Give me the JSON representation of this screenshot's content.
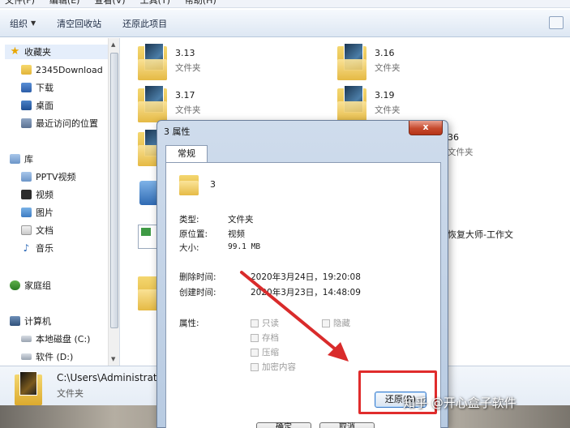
{
  "menubar": {
    "items": [
      "文件(F)",
      "编辑(E)",
      "查看(V)",
      "工具(T)",
      "帮助(H)"
    ]
  },
  "toolbar": {
    "organize_label": "组织",
    "empty_recycle_label": "清空回收站",
    "restore_item_label": "还原此项目"
  },
  "nav": {
    "favorites": "收藏夹",
    "fav_items": [
      "2345Download",
      "下载",
      "桌面",
      "最近访问的位置"
    ],
    "libraries": "库",
    "lib_items": [
      "PPTV视频",
      "视频",
      "图片",
      "文档",
      "音乐"
    ],
    "homegroup": "家庭组",
    "computer": "计算机",
    "drives": [
      "本地磁盘 (C:)",
      "软件 (D:)"
    ]
  },
  "main": {
    "tiles": [
      {
        "name": "3.13",
        "type": "文件夹"
      },
      {
        "name": "3.16",
        "type": "文件夹"
      },
      {
        "name": "3.17",
        "type": "文件夹"
      },
      {
        "name": "3.19",
        "type": "文件夹"
      },
      {
        "name": "36",
        "type": "文件夹"
      },
      {
        "name": "恢复大师-工作文",
        "type": ""
      }
    ]
  },
  "details": {
    "path": "C:\\Users\\Administrat",
    "type": "文件夹"
  },
  "dialog": {
    "title": "3 属性",
    "close_glyph": "x",
    "tab_general": "常规",
    "folder_name": "3",
    "type_label": "类型:",
    "type_value": "文件夹",
    "origin_label": "原位置:",
    "origin_value": "视频",
    "size_label": "大小:",
    "size_value": "99.1 MB",
    "deleted_label": "删除时间:",
    "deleted_value": "2020年3月24日，19:20:08",
    "created_label": "创建时间:",
    "created_value": "2020年3月23日，14:48:09",
    "attributes_label": "属性:",
    "attr_readonly": "只读",
    "attr_hidden": "隐藏",
    "attr_archive": "存档",
    "attr_compress": "压缩",
    "attr_encrypt": "加密内容",
    "restore_button": "还原(R)",
    "bottom_buttons": [
      "确定",
      "取消"
    ]
  },
  "watermark": "知乎 @开心盒子软件",
  "colors": {
    "highlight": "#e02c2c",
    "arrow": "#d92b2b"
  }
}
